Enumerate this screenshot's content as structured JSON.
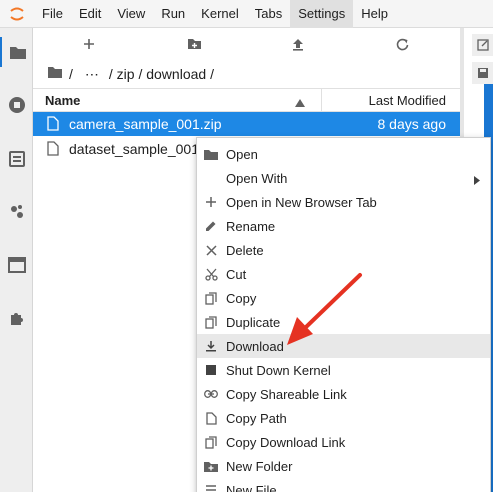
{
  "menubar": {
    "items": [
      "File",
      "Edit",
      "View",
      "Run",
      "Kernel",
      "Tabs",
      "Settings",
      "Help"
    ],
    "active": "Settings"
  },
  "breadcrumb": {
    "ellipsis": "⋯",
    "path": "/ zip / download /",
    "sep": "/"
  },
  "table": {
    "col_name": "Name",
    "col_modified": "Last Modified",
    "rows": [
      {
        "name": "camera_sample_001.zip",
        "modified": "8 days ago"
      },
      {
        "name": "dataset_sample_001",
        "modified": ""
      }
    ]
  },
  "context_menu": {
    "items": [
      {
        "label": "Open",
        "icon": "folder-icon"
      },
      {
        "label": "Open With",
        "icon": "",
        "submenu": "›"
      },
      {
        "label": "Open in New Browser Tab",
        "icon": "plus-icon"
      },
      {
        "label": "Rename",
        "icon": "pencil-icon"
      },
      {
        "label": "Delete",
        "icon": "close-icon"
      },
      {
        "label": "Cut",
        "icon": "scissors-icon"
      },
      {
        "label": "Copy",
        "icon": "copy-icon"
      },
      {
        "label": "Duplicate",
        "icon": "duplicate-icon"
      },
      {
        "label": "Download",
        "icon": "download-icon"
      },
      {
        "label": "Shut Down Kernel",
        "icon": "stop-icon"
      },
      {
        "label": "Copy Shareable Link",
        "icon": "link-icon"
      },
      {
        "label": "Copy Path",
        "icon": "file-icon"
      },
      {
        "label": "Copy Download Link",
        "icon": "copy-icon"
      },
      {
        "label": "New Folder",
        "icon": "new-folder-icon"
      },
      {
        "label": "New File",
        "icon": "new-file-icon"
      }
    ]
  },
  "colors": {
    "selection": "#1e88e5",
    "arrow": "#e53222",
    "hover": "#e8e8e8"
  }
}
